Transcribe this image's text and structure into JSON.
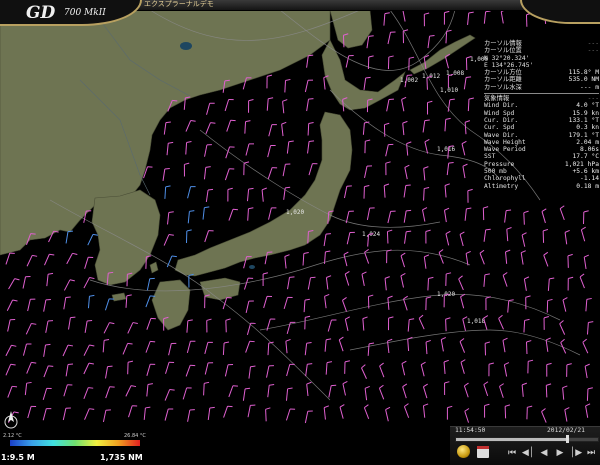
{
  "header": {
    "title": "エクスプラーナルデモ",
    "brand_logo": "GD",
    "brand_model": "700 MkII"
  },
  "position_panel": {
    "header": "カーソル情報",
    "rows": [
      {
        "key": "カーソル位置",
        "value": ""
      },
      {
        "key": "",
        "value": "N 32°20.324'"
      },
      {
        "key": "",
        "value": "E 134°26.745'"
      },
      {
        "key": "カーソル方位",
        "value": "115.8° M"
      },
      {
        "key": "カーソル距離",
        "value": "535.0 NM"
      },
      {
        "key": "カーソル水深",
        "value": "--- m"
      }
    ]
  },
  "weather_panel": {
    "header": "気象情報",
    "rows": [
      {
        "key": "Wind Dir.",
        "value": "4.0 °T"
      },
      {
        "key": "Wind Spd",
        "value": "15.9 kn"
      },
      {
        "key": "Cur. Dir.",
        "value": "133.1 °T"
      },
      {
        "key": "Cur. Spd",
        "value": "0.3 kn"
      },
      {
        "key": "Wave Dir.",
        "value": "179.1 °T"
      },
      {
        "key": "Wave Height",
        "value": "2.04 m"
      },
      {
        "key": "Wave Period",
        "value": "8.06s"
      },
      {
        "key": "SST",
        "value": "17.7 °C"
      },
      {
        "key": "Pressure",
        "value": "1,021 hPa"
      },
      {
        "key": "500 mb",
        "value": "+5.6 km"
      },
      {
        "key": "Chlorophyll",
        "value": "-1.14"
      },
      {
        "key": "Altimetry",
        "value": "0.18 m"
      }
    ]
  },
  "isobars": [
    "1,000",
    "1,010",
    "1,012",
    "1,008",
    "1,016",
    "1,002",
    "1,020",
    "1,024",
    "1,020",
    "1,018"
  ],
  "colorbar": {
    "min_label": "2.12 °C",
    "max_label": "26.84 °C"
  },
  "status": {
    "scale": "1:9.5 M",
    "distance": "1,735 NM",
    "time": "11:54:50",
    "date": "2012/02/21",
    "slider_fraction": 0.78
  },
  "playback": {
    "icons": [
      "skip-back-icon",
      "step-back-icon",
      "play-back-icon",
      "play-icon",
      "step-forward-icon",
      "skip-forward-icon"
    ]
  },
  "colors": {
    "land": "#6e7452",
    "sea": "#000000",
    "wind_pink": "#e060d0",
    "wind_blue": "#4f8fe8",
    "accent_gold": "#b8a060"
  }
}
